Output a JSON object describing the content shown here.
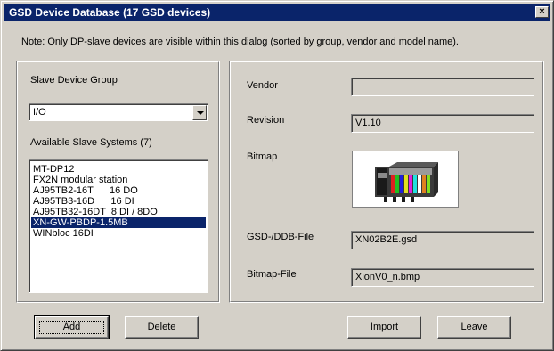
{
  "window": {
    "title": "GSD Device Database (17 GSD devices)",
    "close_glyph": "×",
    "note": "Note: Only DP-slave devices are visible within this dialog (sorted by group, vendor and model name)."
  },
  "left": {
    "group_label": "Slave Device Group",
    "group_value": "I/O",
    "systems_label": "Available Slave Systems (7)",
    "systems": [
      {
        "text": "MT-DP12",
        "selected": false
      },
      {
        "text": "FX2N modular station",
        "selected": false
      },
      {
        "text": "AJ95TB2-16T      16 DO",
        "selected": false
      },
      {
        "text": "AJ95TB3-16D      16 DI",
        "selected": false
      },
      {
        "text": "AJ95TB32-16DT  8 DI / 8DO",
        "selected": false
      },
      {
        "text": "XN-GW-PBDP-1.5MB",
        "selected": true
      },
      {
        "text": "WINbloc 16DI",
        "selected": false
      }
    ]
  },
  "right": {
    "vendor_label": "Vendor",
    "vendor_value": "",
    "revision_label": "Revision",
    "revision_value": "V1.10",
    "bitmap_label": "Bitmap",
    "gsd_label": "GSD-/DDB-File",
    "gsd_value": "XN02B2E.gsd",
    "bitmapfile_label": "Bitmap-File",
    "bitmapfile_value": "XionV0_n.bmp"
  },
  "buttons": {
    "add": "Add",
    "delete": "Delete",
    "import": "Import",
    "leave": "Leave"
  }
}
